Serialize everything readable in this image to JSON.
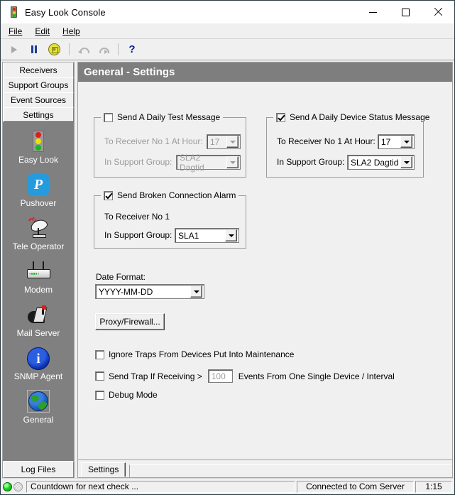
{
  "window": {
    "title": "Easy Look Console",
    "icon": "traffic-light-icon",
    "controls": {
      "minimize": "minimize-icon",
      "maximize": "maximize-icon",
      "close": "close-icon"
    }
  },
  "menubar": [
    {
      "label": "File",
      "accel": "F"
    },
    {
      "label": "Edit",
      "accel": "E"
    },
    {
      "label": "Help",
      "accel": "H"
    }
  ],
  "toolbar": [
    {
      "name": "play-icon",
      "glyph": "▶",
      "enabled": false
    },
    {
      "name": "pause-icon",
      "glyph": "⏸",
      "enabled": true
    },
    {
      "name": "gear-icon",
      "glyph": "⚙",
      "enabled": true
    },
    {
      "name": "undo-icon",
      "glyph": "↶",
      "enabled": false
    },
    {
      "name": "redo-icon",
      "glyph": "↷",
      "enabled": false
    },
    {
      "name": "help-icon",
      "glyph": "?",
      "enabled": true
    }
  ],
  "sidebar": {
    "tabs": [
      {
        "label": "Receivers"
      },
      {
        "label": "Support Groups"
      },
      {
        "label": "Event Sources"
      },
      {
        "label": "Settings",
        "selected": true
      }
    ],
    "items": [
      {
        "label": "Easy Look",
        "icon": "traffic-light-icon"
      },
      {
        "label": "Pushover",
        "icon": "pushover-icon"
      },
      {
        "label": "Tele Operator",
        "icon": "satellite-dish-icon"
      },
      {
        "label": "Modem",
        "icon": "modem-icon"
      },
      {
        "label": "Mail Server",
        "icon": "mailbox-icon"
      },
      {
        "label": "SNMP Agent",
        "icon": "info-circle-icon"
      },
      {
        "label": "General",
        "icon": "globe-icon",
        "selected": true
      }
    ],
    "bottom_tab": {
      "label": "Log Files"
    }
  },
  "panel": {
    "header": "General - Settings",
    "daily_test": {
      "legend": "Send A Daily Test Message",
      "checked": false,
      "enabled": false,
      "hour_label": "To Receiver No 1 At Hour:",
      "hour_value": "17",
      "group_label": "In Support Group:",
      "group_value": "SLA2 Dagtid"
    },
    "daily_device_status": {
      "legend": "Send A Daily Device Status Message",
      "checked": true,
      "enabled": true,
      "hour_label": "To Receiver No 1 At Hour:",
      "hour_value": "17",
      "group_label": "In Support Group:",
      "group_value": "SLA2 Dagtid"
    },
    "broken_connection": {
      "legend": "Send Broken Connection Alarm",
      "checked": true,
      "receiver_label": "To Receiver No 1",
      "group_label": "In Support Group:",
      "group_value": "SLA1"
    },
    "date_format": {
      "label": "Date Format:",
      "value": "YYYY-MM-DD"
    },
    "proxy_button": "Proxy/Firewall...",
    "options": [
      {
        "label": "Ignore Traps From Devices Put Into Maintenance",
        "checked": false
      },
      {
        "label_before": "Send Trap If Receiving >",
        "value": "100",
        "label_after": "Events From One Single Device / Interval",
        "checked": false
      },
      {
        "label": "Debug Mode",
        "checked": false
      }
    ]
  },
  "bottom_tabs": [
    {
      "label": "Settings",
      "selected": true
    }
  ],
  "statusbar": {
    "led_active": "green",
    "led_inactive": "gray",
    "message": "Countdown for next check ...",
    "connection": "Connected to Com Server",
    "time": "1:15"
  },
  "colors": {
    "sidebar_bg": "#808080",
    "header_bg": "#7e7e7e",
    "window_bg": "#f0f0f0",
    "accent_blue": "#249bdd",
    "led_green": "#22d422"
  }
}
